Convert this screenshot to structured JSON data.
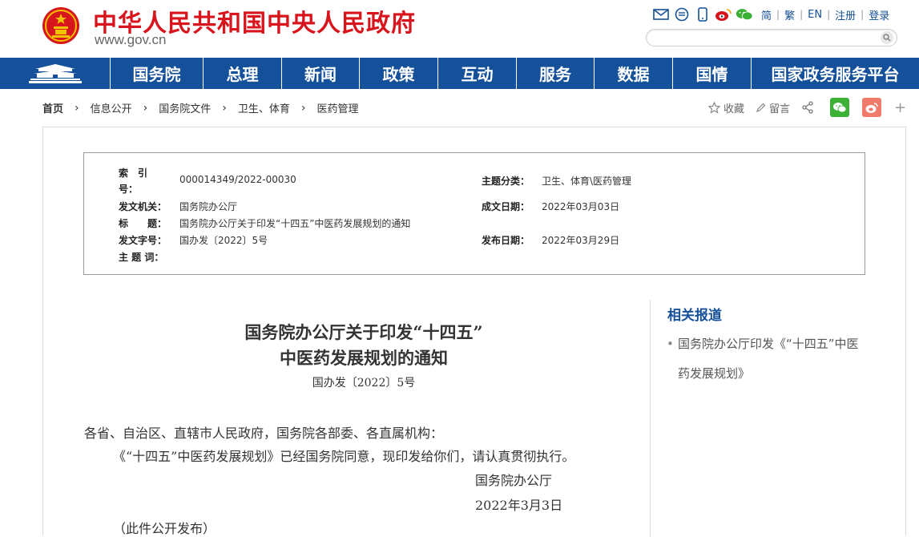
{
  "header": {
    "site_title": "中华人民共和国中央人民政府",
    "site_url": "www.gov.cn",
    "links": [
      "简",
      "繁",
      "EN",
      "注册",
      "登录"
    ],
    "icons": [
      "mail-icon",
      "message-icon",
      "mobile-icon",
      "weibo-icon",
      "wechat-icon"
    ],
    "search_placeholder": ""
  },
  "nav": {
    "items": [
      "国务院",
      "总理",
      "新闻",
      "政策",
      "互动",
      "服务",
      "数据",
      "国情",
      "国家政务服务平台"
    ]
  },
  "breadcrumb": {
    "items": [
      "首页",
      "信息公开",
      "国务院文件",
      "卫生、体育",
      "医药管理"
    ]
  },
  "tools": {
    "favorite": "收藏",
    "comment": "留言"
  },
  "meta": {
    "index_label": "索　引",
    "index_label2": "号：",
    "index_value": "000014349/2022-00030",
    "subject_label": "主题分类：",
    "subject_value": "卫生、体育\\医药管理",
    "issuer_label": "发文机关：",
    "issuer_value": "国务院办公厅",
    "date_written_label": "成文日期：",
    "date_written_value": "2022年03月03日",
    "title_label": "标　　题：",
    "title_value": "国务院办公厅关于印发“十四五”中医药发展规划的通知",
    "docno_label": "发文字号：",
    "docno_value": "国办发〔2022〕5号",
    "publish_label": "发布日期：",
    "publish_value": "2022年03月29日",
    "keywords_label": "主 题 词："
  },
  "article": {
    "title_line1": "国务院办公厅关于印发“十四五”",
    "title_line2": "中医药发展规划的通知",
    "doc_number": "国办发〔2022〕5号",
    "salutation": "各省、自治区、直辖市人民政府，国务院各部委、各直属机构：",
    "paragraph1": "《“十四五”中医药发展规划》已经国务院同意，现印发给你们，请认真贯彻执行。",
    "signer": "国务院办公厅",
    "sign_date": "2022年3月3日",
    "note": "（此件公开发布）"
  },
  "related": {
    "title": "相关报道",
    "items": [
      "国务院办公厅印发《“十四五”中医药发展规划》"
    ]
  },
  "colors": {
    "brand_red": "#d8141d",
    "nav_blue": "#15509a",
    "wechat_green": "#3ab035",
    "weibo_orange": "#f07b6b"
  }
}
